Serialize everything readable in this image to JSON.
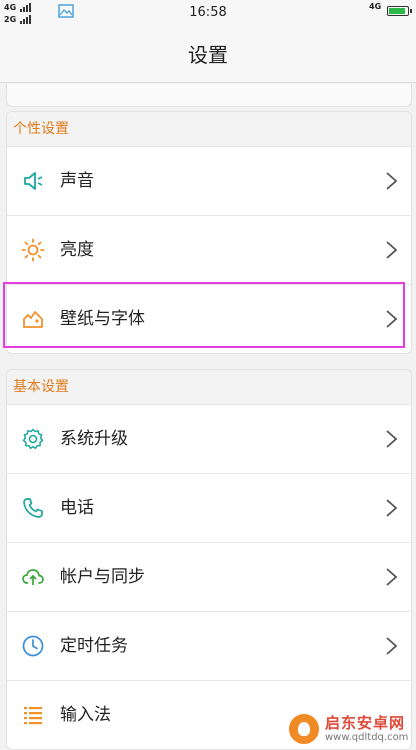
{
  "status": {
    "left_network_top": "4G",
    "left_network_bottom": "2G",
    "time": "16:58",
    "right_network": "4G",
    "battery_level": 0.9,
    "battery_color": "#2db84a"
  },
  "header": {
    "title": "设置"
  },
  "sections": [
    {
      "title": "个性设置",
      "items": [
        {
          "label": "声音",
          "icon": "speaker-icon"
        },
        {
          "label": "亮度",
          "icon": "brightness-icon"
        },
        {
          "label": "壁纸与字体",
          "icon": "wallpaper-icon"
        }
      ]
    },
    {
      "title": "基本设置",
      "items": [
        {
          "label": "系统升级",
          "icon": "system-update-icon"
        },
        {
          "label": "电话",
          "icon": "phone-icon"
        },
        {
          "label": "帐户与同步",
          "icon": "cloud-sync-icon"
        },
        {
          "label": "定时任务",
          "icon": "clock-icon"
        },
        {
          "label": "输入法",
          "icon": "keyboard-icon"
        }
      ]
    }
  ],
  "watermark": {
    "title": "启东安卓网",
    "url": "www.qdltdq.com"
  },
  "colors": {
    "accent": "#e07b1e",
    "icon_teal": "#1aa7a0",
    "highlight": "#e23ee0"
  }
}
